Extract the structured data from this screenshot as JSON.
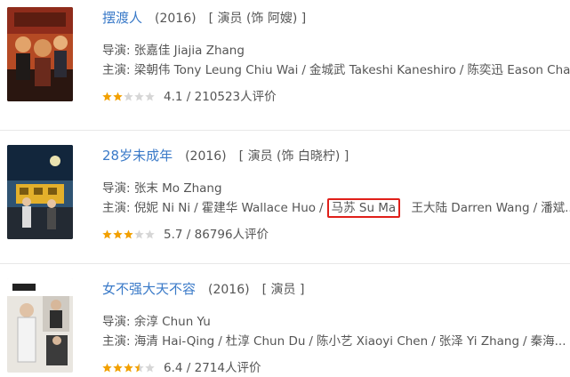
{
  "items": [
    {
      "title": "摆渡人",
      "year": "(2016)",
      "role": "[ 演员 (饰 阿嫂) ]",
      "director_label": "导演:",
      "director": "张嘉佳 Jiajia Zhang",
      "cast_label": "主演:",
      "cast": [
        "梁朝伟 Tony Leung Chiu Wai",
        "金城武 Takeshi Kaneshiro",
        "陈奕迅 Eason Cha..."
      ],
      "rating_text": "4.1 / 210523人评价",
      "stars": 2
    },
    {
      "title": "28岁未成年",
      "year": "(2016)",
      "role": "[ 演员 (饰 白晓柠) ]",
      "director_label": "导演:",
      "director": "张末 Mo Zhang",
      "cast_label": "主演:",
      "cast": [
        "倪妮 Ni Ni",
        "霍建华 Wallace Huo",
        "马苏 Su Ma",
        "王大陆 Darren Wang",
        "潘斌..."
      ],
      "rating_text": "5.7 / 86796人评价",
      "stars": 3
    },
    {
      "title": "女不强大天不容",
      "year": "(2016)",
      "role": "[ 演员 ]",
      "director_label": "导演:",
      "director": "余淳 Chun Yu",
      "cast_label": "主演:",
      "cast": [
        "海清 Hai-Qing",
        "杜淳 Chun Du",
        "陈小艺 Xiaoyi Chen",
        "张泽 Yi Zhang",
        "秦海..."
      ],
      "rating_text": "6.4 / 2714人评价",
      "stars": 3.5
    }
  ],
  "colors": {
    "link": "#3a7ac8",
    "highlight_box": "#e0201a",
    "star_filled": "#f2a000",
    "star_empty": "#d6d6d6"
  },
  "icons": {
    "rating": "star-icon"
  }
}
